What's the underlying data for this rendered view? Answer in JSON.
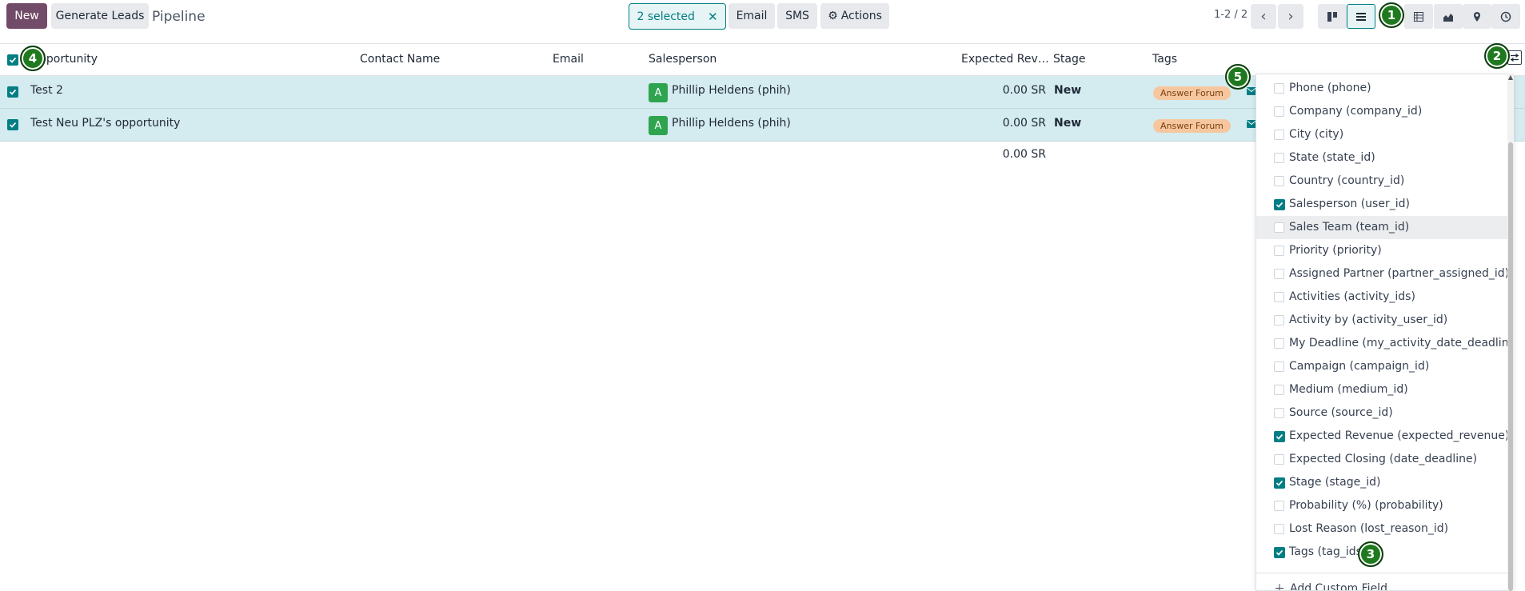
{
  "control_panel": {
    "new_label": "New",
    "generate_leads_label": "Generate Leads",
    "breadcrumb": "Pipeline",
    "selected_label": "2 selected",
    "clear_selection_icon": "close-icon",
    "email_label": "Email",
    "sms_label": "SMS",
    "actions_label": "Actions",
    "pager_value": "1-2 / 2"
  },
  "view_switcher": {
    "views": [
      "kanban",
      "list",
      "pivot",
      "graph",
      "map",
      "activity"
    ],
    "active": "list"
  },
  "list": {
    "headers": {
      "opportunity": "Opportunity",
      "contact_name": "Contact Name",
      "email": "Email",
      "salesperson": "Salesperson",
      "expected_revenue": "Expected Rev…",
      "stage": "Stage",
      "tags": "Tags"
    },
    "rows": [
      {
        "opportunity": "Test 2",
        "contact_name": "",
        "email": "",
        "salesperson_initial": "A",
        "salesperson": "Phillip Heldens (phih)",
        "expected_revenue": "0.00 SR",
        "stage": "New",
        "tag": "Answer Forum",
        "selected": true
      },
      {
        "opportunity": "Test Neu PLZ's opportunity",
        "contact_name": "",
        "email": "",
        "salesperson_initial": "A",
        "salesperson": "Phillip Heldens (phih)",
        "expected_revenue": "0.00 SR",
        "stage": "New",
        "tag": "Answer Forum",
        "selected": true
      }
    ],
    "total_revenue": "0.00 SR"
  },
  "optional_columns": {
    "items": [
      {
        "label": "Phone (phone)",
        "checked": false
      },
      {
        "label": "Company (company_id)",
        "checked": false
      },
      {
        "label": "City (city)",
        "checked": false
      },
      {
        "label": "State (state_id)",
        "checked": false
      },
      {
        "label": "Country (country_id)",
        "checked": false
      },
      {
        "label": "Salesperson (user_id)",
        "checked": true
      },
      {
        "label": "Sales Team (team_id)",
        "checked": false
      },
      {
        "label": "Priority (priority)",
        "checked": false
      },
      {
        "label": "Assigned Partner (partner_assigned_id)",
        "checked": false
      },
      {
        "label": "Activities (activity_ids)",
        "checked": false
      },
      {
        "label": "Activity by (activity_user_id)",
        "checked": false
      },
      {
        "label": "My Deadline (my_activity_date_deadline)",
        "checked": false
      },
      {
        "label": "Campaign (campaign_id)",
        "checked": false
      },
      {
        "label": "Medium (medium_id)",
        "checked": false
      },
      {
        "label": "Source (source_id)",
        "checked": false
      },
      {
        "label": "Expected Revenue (expected_revenue)",
        "checked": true
      },
      {
        "label": "Expected Closing (date_deadline)",
        "checked": false
      },
      {
        "label": "Stage (stage_id)",
        "checked": true
      },
      {
        "label": "Probability (%) (probability)",
        "checked": false
      },
      {
        "label": "Lost Reason (lost_reason_id)",
        "checked": false
      },
      {
        "label": "Tags (tag_ids)",
        "checked": true
      }
    ],
    "add_custom_field_label": "Add Custom Field"
  },
  "markers": [
    "1",
    "2",
    "3",
    "4",
    "5"
  ],
  "colors": {
    "primary": "#714B67",
    "accent": "#017e84",
    "selected_row": "#d4ebef",
    "avatar": "#2ea44f",
    "tag_bg": "#f6c79e",
    "marker": "#1f7a1f"
  }
}
